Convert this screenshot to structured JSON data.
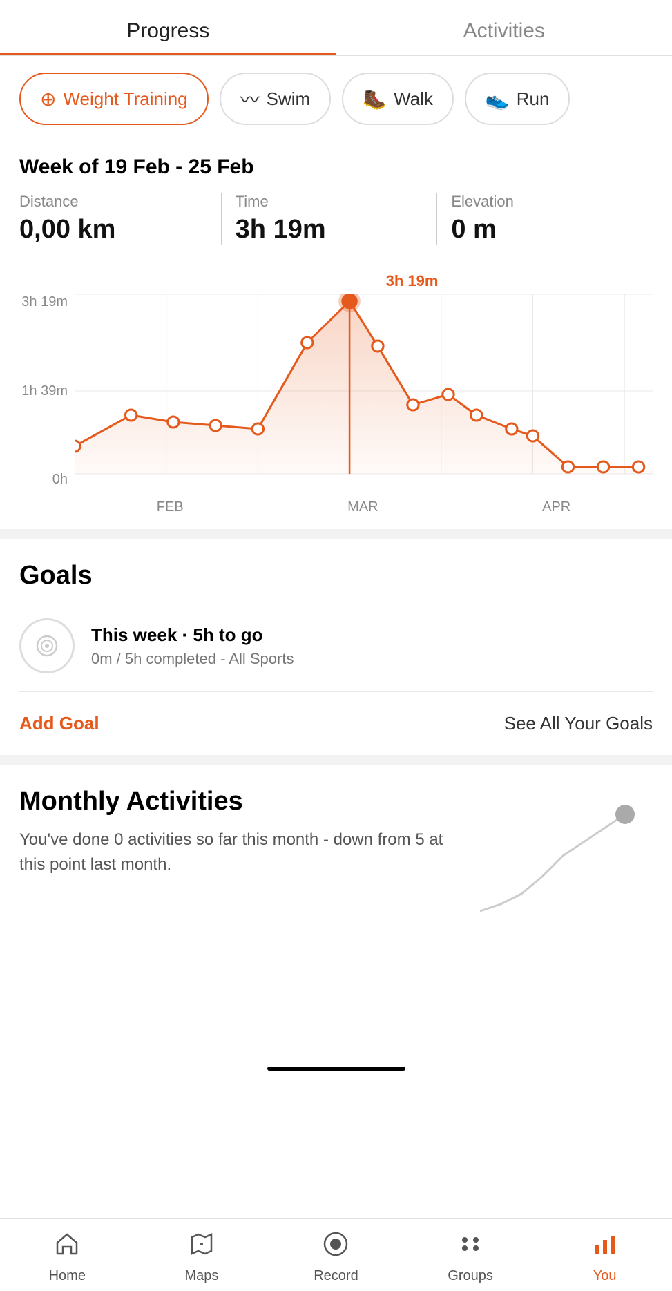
{
  "tabs": {
    "progress": "Progress",
    "activities": "Activities",
    "active": "progress"
  },
  "filters": [
    {
      "id": "weight-training",
      "label": "Weight Training",
      "icon": "🏋️",
      "active": true
    },
    {
      "id": "swim",
      "label": "Swim",
      "icon": "🌊",
      "active": false
    },
    {
      "id": "walk",
      "label": "Walk",
      "icon": "🥾",
      "active": false
    },
    {
      "id": "run",
      "label": "Run",
      "icon": "👟",
      "active": false
    }
  ],
  "week": {
    "title": "Week of 19 Feb - 25 Feb",
    "stats": [
      {
        "label": "Distance",
        "value": "0,00 km"
      },
      {
        "label": "Time",
        "value": "3h 19m"
      },
      {
        "label": "Elevation",
        "value": "0 m"
      }
    ]
  },
  "chart": {
    "tooltip": "3h 19m",
    "yLabels": [
      "3h 19m",
      "1h 39m",
      "0h"
    ],
    "xLabels": [
      "FEB",
      "MAR",
      "APR"
    ]
  },
  "goals": {
    "title": "Goals",
    "item": {
      "title": "This week · 5h to go",
      "subtitle": "0m / 5h completed - All Sports"
    },
    "add_label": "Add Goal",
    "see_all_label": "See All Your Goals"
  },
  "monthly": {
    "title": "Monthly Activities",
    "description": "You've done 0 activities so far this month - down from 5 at this point last month."
  },
  "nav": [
    {
      "id": "home",
      "label": "Home",
      "icon": "🏠",
      "active": false
    },
    {
      "id": "maps",
      "label": "Maps",
      "icon": "📍",
      "active": false
    },
    {
      "id": "record",
      "label": "Record",
      "icon": "⏺",
      "active": false
    },
    {
      "id": "groups",
      "label": "Groups",
      "icon": "⠿",
      "active": false
    },
    {
      "id": "you",
      "label": "You",
      "icon": "📊",
      "active": true
    }
  ]
}
